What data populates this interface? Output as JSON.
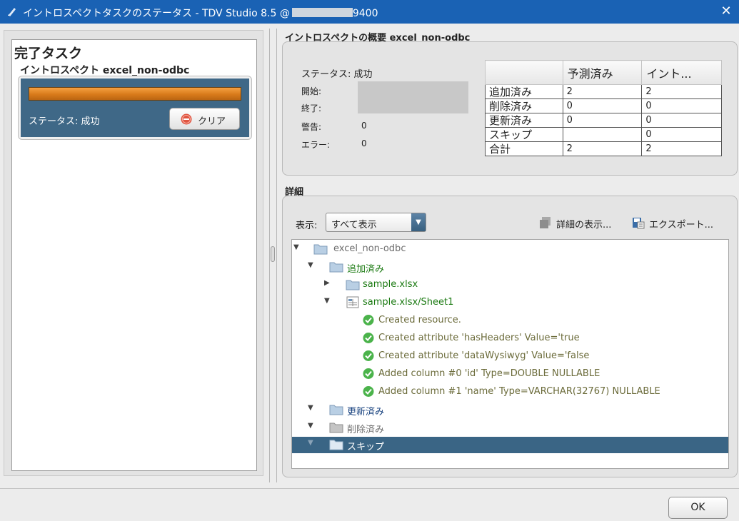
{
  "window": {
    "title_prefix": "イントロスペクトタスクのステータス - TDV Studio 8.5 @",
    "title_suffix": "9400",
    "close_glyph": "✕"
  },
  "left": {
    "heading": "完了タスク",
    "task_name": "イントロスペクト excel_non-odbc",
    "progress_percent": 100,
    "status_text": "ステータス: 成功",
    "clear_label": "クリア"
  },
  "summary": {
    "title": "イントロスペクトの概要  excel_non-odbc",
    "status_text": "ステータス: 成功",
    "start_label": "開始:",
    "end_label": "終了:",
    "warn_label": "警告:",
    "warn_value": "0",
    "error_label": "エラー:",
    "error_value": "0",
    "table": {
      "headers": [
        "",
        "予測済み",
        "イント..."
      ],
      "rows": [
        [
          "追加済み",
          "2",
          "2"
        ],
        [
          "削除済み",
          "0",
          "0"
        ],
        [
          "更新済み",
          "0",
          "0"
        ],
        [
          "スキップ",
          "",
          "0"
        ],
        [
          "合計",
          "2",
          "2"
        ]
      ]
    }
  },
  "details": {
    "title": "詳細",
    "show_label": "表示:",
    "show_value": "すべて表示",
    "detail_button": "詳細の表示...",
    "export_button": "エクスポート...",
    "tree": [
      {
        "label": "excel_non-odbc",
        "depth": 0,
        "arrow": "▼",
        "icon": "folder",
        "color": "gray"
      },
      {
        "label": "追加済み",
        "depth": 1,
        "arrow": "▼",
        "icon": "folder",
        "color": "green"
      },
      {
        "label": "sample.xlsx",
        "depth": 2,
        "arrow": "▶",
        "icon": "folder",
        "color": "green"
      },
      {
        "label": "sample.xlsx/Sheet1",
        "depth": 2,
        "arrow": "▼",
        "icon": "table",
        "color": "green"
      },
      {
        "label": "Created resource.",
        "depth": 3,
        "arrow": "",
        "icon": "check",
        "color": "log"
      },
      {
        "label": "Created attribute 'hasHeaders' Value='true",
        "depth": 3,
        "arrow": "",
        "icon": "check",
        "color": "log"
      },
      {
        "label": "Created attribute 'dataWysiwyg' Value='false",
        "depth": 3,
        "arrow": "",
        "icon": "check",
        "color": "log"
      },
      {
        "label": "Added column #0 'id' Type=DOUBLE NULLABLE",
        "depth": 3,
        "arrow": "",
        "icon": "check",
        "color": "log"
      },
      {
        "label": "Added column #1 'name' Type=VARCHAR(32767) NULLABLE",
        "depth": 3,
        "arrow": "",
        "icon": "check",
        "color": "log"
      },
      {
        "label": "更新済み",
        "depth": 1,
        "arrow": "▼",
        "icon": "folder",
        "color": "navy"
      },
      {
        "label": "削除済み",
        "depth": 1,
        "arrow": "▼",
        "icon": "folder",
        "color": "gray"
      },
      {
        "label": "スキップ",
        "depth": 1,
        "arrow": "▼",
        "icon": "folder",
        "color": "selected"
      }
    ]
  },
  "footer": {
    "ok_label": "OK"
  },
  "colors": {
    "titlebar": "#1a62b4",
    "task_card": "#3f6887",
    "progress": "#d87a1a",
    "selection": "#3a6585"
  }
}
